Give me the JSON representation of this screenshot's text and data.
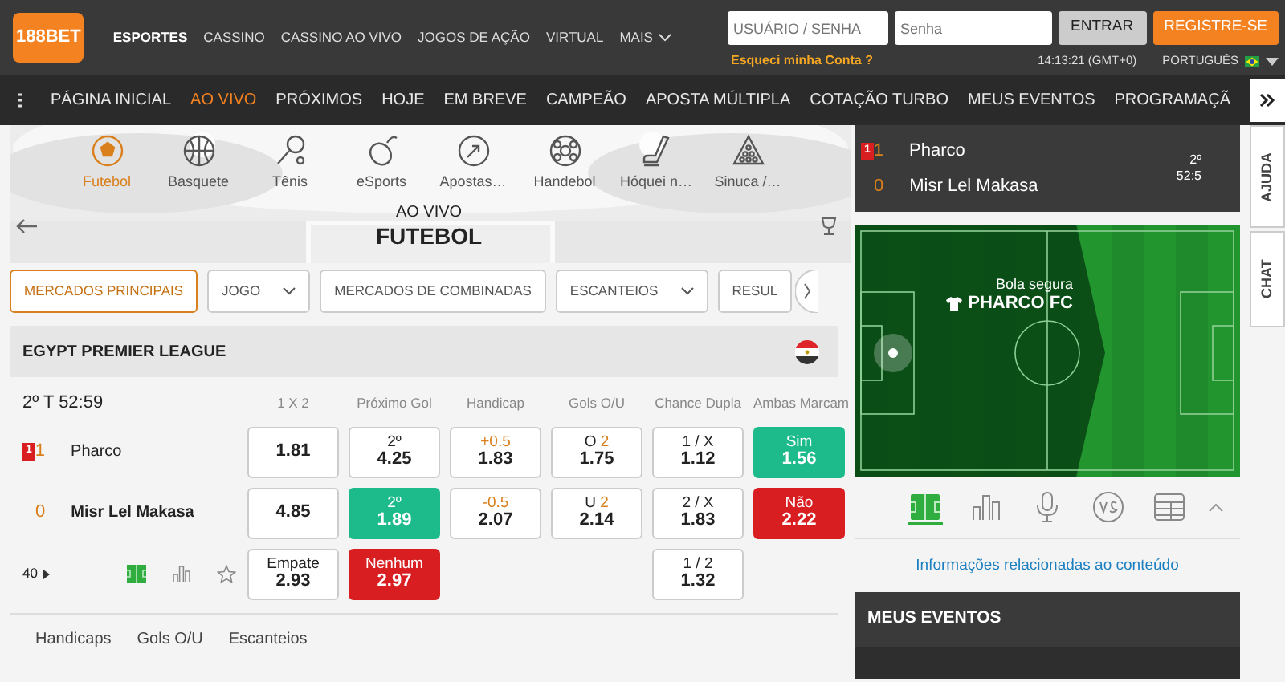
{
  "header": {
    "logo": "188BET",
    "top_nav": [
      {
        "label": "ESPORTES",
        "selected": true,
        "dropdown": false
      },
      {
        "label": "CASSINO",
        "selected": false,
        "dropdown": false
      },
      {
        "label": "CASSINO AO VIVO",
        "selected": false,
        "dropdown": false
      },
      {
        "label": "JOGOS DE AÇÃO",
        "selected": false,
        "dropdown": false
      },
      {
        "label": "VIRTUAL",
        "selected": false,
        "dropdown": false
      },
      {
        "label": "MAIS",
        "selected": false,
        "dropdown": true
      }
    ],
    "login": {
      "username_placeholder": "USUÁRIO / SENHA",
      "password_placeholder": "Senha",
      "login_button": "ENTRAR",
      "register_button": "REGISTRE-SE",
      "forgot_link": "Esqueci minha Conta ?"
    },
    "clock": "14:13:21 (GMT+0)",
    "language": "PORTUGUÊS"
  },
  "main_nav": [
    {
      "label": "PÁGINA INICIAL",
      "selected": false
    },
    {
      "label": "AO VIVO",
      "selected": true
    },
    {
      "label": "PRÓXIMOS",
      "selected": false
    },
    {
      "label": "HOJE",
      "selected": false
    },
    {
      "label": "EM BREVE",
      "selected": false
    },
    {
      "label": "CAMPEÃO",
      "selected": false
    },
    {
      "label": "APOSTA MÚLTIPLA",
      "selected": false
    },
    {
      "label": "COTAÇÃO TURBO",
      "selected": false
    },
    {
      "label": "MEUS EVENTOS",
      "selected": false
    },
    {
      "label": "PROGRAMAÇÃ",
      "selected": false
    }
  ],
  "sports": [
    {
      "label": "Futebol",
      "selected": true
    },
    {
      "label": "Basquete",
      "selected": false
    },
    {
      "label": "Tênis",
      "selected": false
    },
    {
      "label": "eSports",
      "selected": false
    },
    {
      "label": "Apostas…",
      "selected": false
    },
    {
      "label": "Handebol",
      "selected": false
    },
    {
      "label": "Hóquei n…",
      "selected": false
    },
    {
      "label": "Sinuca /…",
      "selected": false
    }
  ],
  "hero": {
    "overline": "AO VIVO",
    "title": "FUTEBOL"
  },
  "market_filters": [
    {
      "label": "MERCADOS PRINCIPAIS",
      "selected": true,
      "dropdown": false
    },
    {
      "label": "JOGO",
      "selected": false,
      "dropdown": true
    },
    {
      "label": "MERCADOS DE COMBINADAS",
      "selected": false,
      "dropdown": false
    },
    {
      "label": "ESCANTEIOS",
      "selected": false,
      "dropdown": true
    },
    {
      "label": "RESUL",
      "selected": false,
      "dropdown": false
    }
  ],
  "league": {
    "name": "EGYPT PREMIER LEAGUE"
  },
  "match": {
    "period": "2º T 52:59",
    "columns": [
      "1 X 2",
      "Próximo Gol",
      "Handicap",
      "Gols O/U",
      "Chance Dupla",
      "Ambas Marcam"
    ],
    "teams": [
      {
        "name": "Pharco",
        "score": "1",
        "red_cards": "1",
        "highlighted": false
      },
      {
        "name": "Misr Lel Makasa",
        "score": "0",
        "highlighted": true
      }
    ],
    "more_markets": "40",
    "markets": [
      {
        "odds": [
          {
            "value": "1.81",
            "kind": "plain"
          },
          {
            "value": "4.85",
            "kind": "plain"
          },
          {
            "label": "Empate",
            "value": "2.93",
            "kind": "plain"
          }
        ]
      },
      {
        "odds": [
          {
            "label": "2º",
            "value": "4.25",
            "kind": "plain"
          },
          {
            "label": "2º",
            "value": "1.89",
            "kind": "up"
          },
          {
            "label": "Nenhum",
            "value": "2.97",
            "kind": "down"
          }
        ]
      },
      {
        "odds": [
          {
            "line": "+0.5",
            "value": "1.83",
            "kind": "plain"
          },
          {
            "line": "-0.5",
            "value": "2.07",
            "kind": "plain"
          }
        ]
      },
      {
        "odds": [
          {
            "label": "O",
            "line": "2",
            "value": "1.75",
            "kind": "plain"
          },
          {
            "label": "U",
            "line": "2",
            "value": "2.14",
            "kind": "plain"
          }
        ]
      },
      {
        "odds": [
          {
            "label": "1 / X",
            "value": "1.12",
            "kind": "plain"
          },
          {
            "label": "2 / X",
            "value": "1.83",
            "kind": "plain"
          },
          {
            "label": "1 / 2",
            "value": "1.32",
            "kind": "plain"
          }
        ]
      },
      {
        "odds": [
          {
            "label": "Sim",
            "value": "1.56",
            "kind": "up"
          },
          {
            "label": "Não",
            "value": "2.22",
            "kind": "down"
          }
        ]
      }
    ]
  },
  "bottom_tabs": [
    "Handicaps",
    "Gols O/U",
    "Escanteios"
  ],
  "scoreboard": {
    "teams": [
      {
        "name": "Pharco",
        "score": "1",
        "red_cards": "1"
      },
      {
        "name": "Misr Lel Makasa",
        "score": "0"
      }
    ],
    "period": "2º",
    "clock": "52:5"
  },
  "pitch": {
    "status": "Bola segura",
    "team": "PHARCO FC"
  },
  "widget_tabs": [
    {
      "selected": true
    },
    {
      "selected": false
    },
    {
      "selected": false
    },
    {
      "selected": false
    },
    {
      "selected": false
    }
  ],
  "related_link": "Informações relacionadas ao conteúdo",
  "my_events": {
    "title": "MEUS EVENTOS"
  },
  "side_tabs": [
    "AJUDA",
    "CHAT"
  ]
}
